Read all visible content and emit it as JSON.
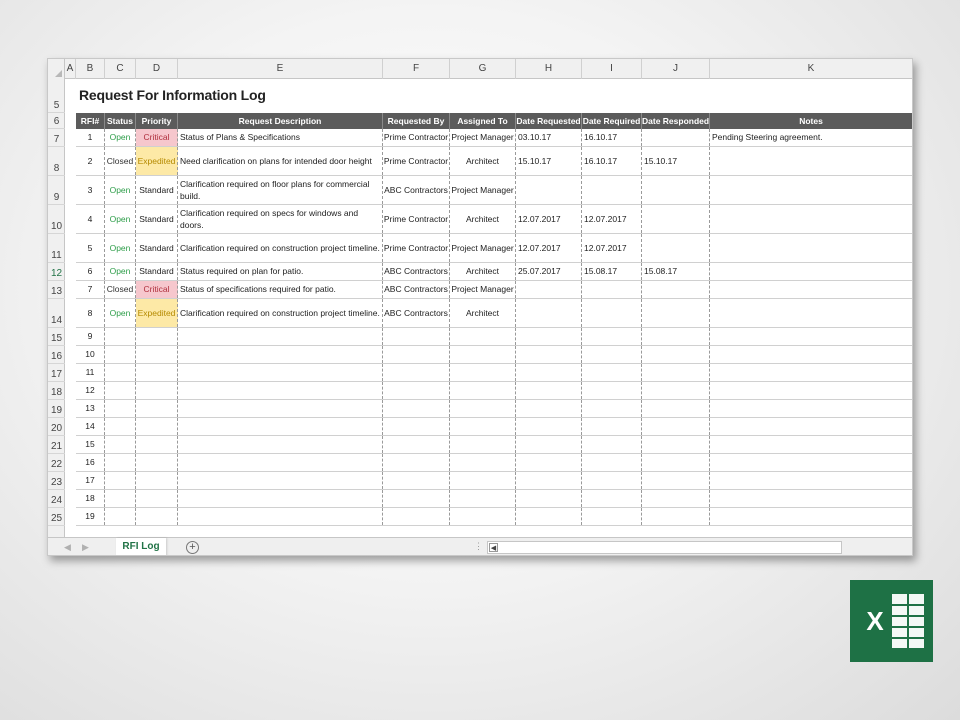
{
  "sheet": {
    "title": "Request For Information Log",
    "tab_label": "RFI Log",
    "column_letters": [
      "A",
      "B",
      "C",
      "D",
      "E",
      "F",
      "G",
      "H",
      "I",
      "J",
      "K"
    ],
    "headers": [
      "RFI#",
      "Status",
      "Priority",
      "Request Description",
      "Requested By",
      "Assigned To",
      "Date Requested",
      "Date Required",
      "Date Responded",
      "Notes"
    ],
    "row_numbers": [
      "5",
      "6",
      "7",
      "8",
      "9",
      "10",
      "11",
      "12",
      "13",
      "14",
      "15",
      "16",
      "17",
      "18",
      "19",
      "20",
      "21",
      "22",
      "23",
      "24",
      "25"
    ],
    "rows": [
      {
        "num": "1",
        "status": "Open",
        "priority": "Critical",
        "desc": "Status of Plans & Specifications",
        "by": "Prime Contractor",
        "to": "Project Manager",
        "req": "03.10.17",
        "due": "16.10.17",
        "resp": "",
        "notes": "Pending Steering agreement."
      },
      {
        "num": "2",
        "status": "Closed",
        "priority": "Expedited",
        "desc": "Need clarification on plans for intended door height",
        "by": "Prime Contractor",
        "to": "Architect",
        "req": "15.10.17",
        "due": "16.10.17",
        "resp": "15.10.17",
        "notes": ""
      },
      {
        "num": "3",
        "status": "Open",
        "priority": "Standard",
        "desc": "Clarification required on floor plans for commercial build.",
        "by": "ABC Contractors",
        "to": "Project Manager",
        "req": "",
        "due": "",
        "resp": "",
        "notes": ""
      },
      {
        "num": "4",
        "status": "Open",
        "priority": "Standard",
        "desc": "Clarification required on specs for windows and doors.",
        "by": "Prime Contractor",
        "to": "Architect",
        "req": "12.07.2017",
        "due": "12.07.2017",
        "resp": "",
        "notes": ""
      },
      {
        "num": "5",
        "status": "Open",
        "priority": "Standard",
        "desc": "Clarification required on construction project timeline.",
        "by": "Prime Contractor",
        "to": "Project Manager",
        "req": "12.07.2017",
        "due": "12.07.2017",
        "resp": "",
        "notes": ""
      },
      {
        "num": "6",
        "status": "Open",
        "priority": "Standard",
        "desc": "Status required on plan for patio.",
        "by": "ABC Contractors",
        "to": "Architect",
        "req": "25.07.2017",
        "due": "15.08.17",
        "resp": "15.08.17",
        "notes": ""
      },
      {
        "num": "7",
        "status": "Closed",
        "priority": "Critical",
        "desc": "Status of specifications required for patio.",
        "by": "ABC Contractors",
        "to": "Project Manager",
        "req": "",
        "due": "",
        "resp": "",
        "notes": ""
      },
      {
        "num": "8",
        "status": "Open",
        "priority": "Expedited",
        "desc": "Clarification required on construction project timeline.",
        "by": "ABC Contractors",
        "to": "Architect",
        "req": "",
        "due": "",
        "resp": "",
        "notes": ""
      },
      {
        "num": "9"
      },
      {
        "num": "10"
      },
      {
        "num": "11"
      },
      {
        "num": "12"
      },
      {
        "num": "13"
      },
      {
        "num": "14"
      },
      {
        "num": "15"
      },
      {
        "num": "16"
      },
      {
        "num": "17"
      },
      {
        "num": "18"
      },
      {
        "num": "19"
      }
    ],
    "active_row": "12"
  },
  "logo": {
    "letter": "X",
    "color": "#217346",
    "name": "excel-logo-icon"
  },
  "icons": {
    "add_sheet": "plus-circle-icon",
    "scroll_left": "scroll-left-arrow-icon",
    "nav_prev": "sheet-nav-prev-icon",
    "nav_next": "sheet-nav-next-icon"
  }
}
